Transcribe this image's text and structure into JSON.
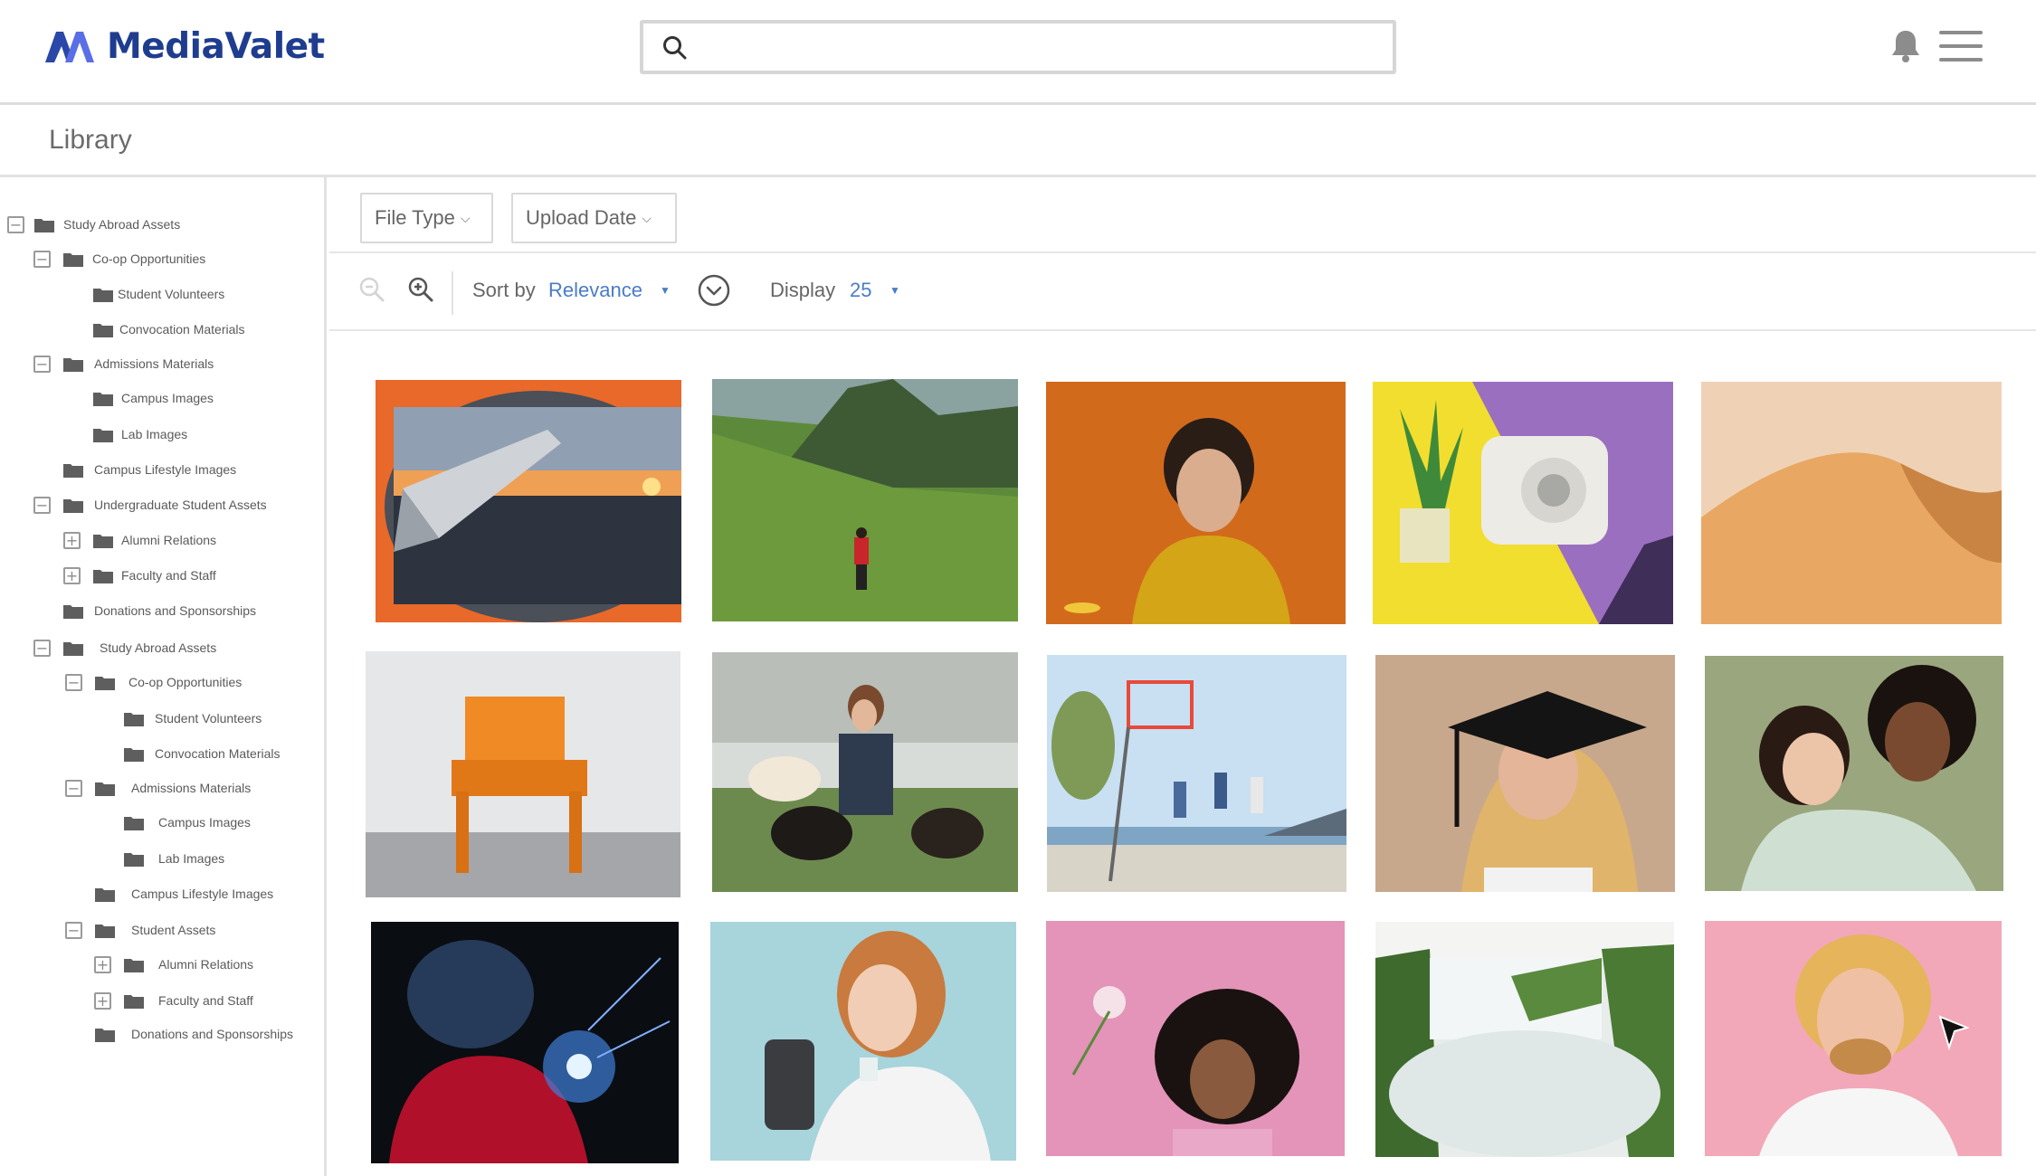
{
  "brand": {
    "name": "MediaValet"
  },
  "search": {
    "placeholder": "",
    "value": ""
  },
  "library": {
    "title": "Library"
  },
  "tree": [
    {
      "label": "Study Abroad Assets",
      "toggle": "−"
    },
    {
      "label": "Co-op Opportunities",
      "toggle": "−"
    },
    {
      "label": "Student Volunteers",
      "toggle": ""
    },
    {
      "label": "Convocation Materials",
      "toggle": ""
    },
    {
      "label": "Admissions Materials",
      "toggle": "−"
    },
    {
      "label": "Campus Images",
      "toggle": ""
    },
    {
      "label": "Lab Images",
      "toggle": ""
    },
    {
      "label": "Campus Lifestyle Images",
      "toggle": ""
    },
    {
      "label": "Undergraduate Student Assets",
      "toggle": "−"
    },
    {
      "label": "Alumni Relations",
      "toggle": "+"
    },
    {
      "label": "Faculty and Staff",
      "toggle": "+"
    },
    {
      "label": "Donations and Sponsorships",
      "toggle": ""
    },
    {
      "label": "Study Abroad Assets",
      "toggle": "−"
    },
    {
      "label": "Co-op Opportunities",
      "toggle": "−"
    },
    {
      "label": "Student Volunteers",
      "toggle": ""
    },
    {
      "label": "Convocation Materials",
      "toggle": ""
    },
    {
      "label": "Admissions Materials",
      "toggle": "−"
    },
    {
      "label": "Campus Images",
      "toggle": ""
    },
    {
      "label": "Lab Images",
      "toggle": ""
    },
    {
      "label": "Campus Lifestyle Images",
      "toggle": ""
    },
    {
      "label": "Student Assets",
      "toggle": "−"
    },
    {
      "label": "Alumni Relations",
      "toggle": "+"
    },
    {
      "label": "Faculty and Staff",
      "toggle": "+"
    },
    {
      "label": "Donations and Sponsorships",
      "toggle": ""
    }
  ],
  "filters": {
    "file_type": "File Type",
    "upload_date": "Upload Date"
  },
  "toolbar": {
    "sort_label": "Sort by",
    "sort_value": "Relevance",
    "display_label": "Display",
    "display_value": "25"
  },
  "assets": [
    {
      "icon": "airplane-window-sunset-image"
    },
    {
      "icon": "hiker-green-hills-image"
    },
    {
      "icon": "curly-hair-man-orange-image"
    },
    {
      "icon": "instant-camera-plant-image"
    },
    {
      "icon": "desert-dune-image"
    },
    {
      "icon": "orange-chair-image"
    },
    {
      "icon": "woman-with-dogs-image"
    },
    {
      "icon": "beach-basketball-image"
    },
    {
      "icon": "graduate-cap-image"
    },
    {
      "icon": "two-women-hugging-image"
    },
    {
      "icon": "welder-sparks-image"
    },
    {
      "icon": "woman-phone-selfie-image"
    },
    {
      "icon": "woman-flower-pink-image"
    },
    {
      "icon": "waterfall-image"
    },
    {
      "icon": "blond-man-pink-image"
    }
  ],
  "colors": {
    "brand_blue": "#1f3d8f",
    "brand_accent": "#4a62d8",
    "link_blue": "#4a7cc8",
    "border": "#dcdcdc"
  }
}
